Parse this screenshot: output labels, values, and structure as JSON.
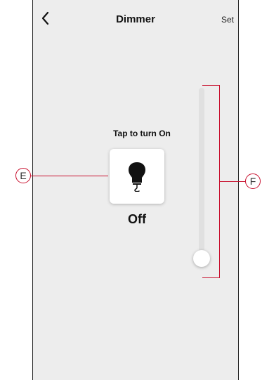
{
  "header": {
    "title": "Dimmer",
    "set_label": "Set"
  },
  "main": {
    "tap_label": "Tap to turn On",
    "state_label": "Off",
    "tile_icon": "light-bulb-icon",
    "brightness_fraction": 0.0
  },
  "callouts": {
    "left_label": "E",
    "right_label": "F",
    "color": "#c8102e"
  },
  "colors": {
    "screen_background": "#ededed",
    "tile_background": "#ffffff",
    "slider_track": "#e0e0e0"
  }
}
